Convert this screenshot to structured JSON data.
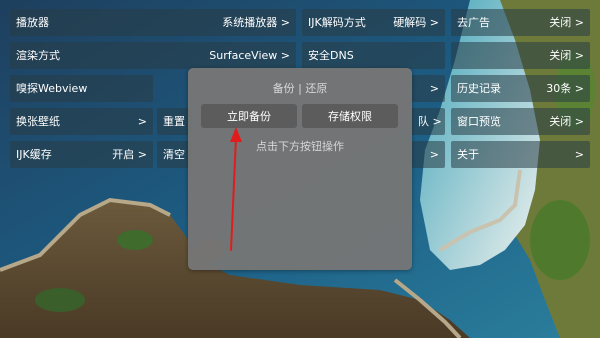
{
  "settings": {
    "player": {
      "label": "播放器",
      "value": "系统播放器 >"
    },
    "decoder": {
      "label": "IJK解码方式",
      "value": "硬解码 >"
    },
    "ads": {
      "label": "去广告",
      "value": "关闭 >"
    },
    "render": {
      "label": "渲染方式",
      "value": "SurfaceView >"
    },
    "dns": {
      "label": "安全DNS",
      "value": ""
    },
    "dns_right": {
      "label": "",
      "value": "关闭 >"
    },
    "sniff": {
      "label": "嗅探Webview",
      "value": ""
    },
    "sniff_mid": {
      "label": "",
      "value": ">"
    },
    "history": {
      "label": "历史记录",
      "value": "30条 >"
    },
    "wallpaper": {
      "label": "换张壁纸",
      "value": ">"
    },
    "reset": {
      "label": "重置",
      "value": ""
    },
    "reset_right": {
      "label": "",
      "value": "队 >"
    },
    "preview": {
      "label": "窗口预览",
      "value": "关闭 >"
    },
    "ijk_cache": {
      "label": "IJK缓存",
      "value": "开启 >"
    },
    "clear": {
      "label": "清空",
      "value": ""
    },
    "clear_right": {
      "label": "",
      "value": ">"
    },
    "about": {
      "label": "关于",
      "value": ">"
    }
  },
  "dialog": {
    "title": "备份 | 还原",
    "backup_button": "立即备份",
    "storage_button": "存储权限",
    "hint": "点击下方按钮操作"
  },
  "colors": {
    "dialog_bg": "#767676",
    "button_bg": "#5c5c5c",
    "arrow": "#e11c1c"
  }
}
